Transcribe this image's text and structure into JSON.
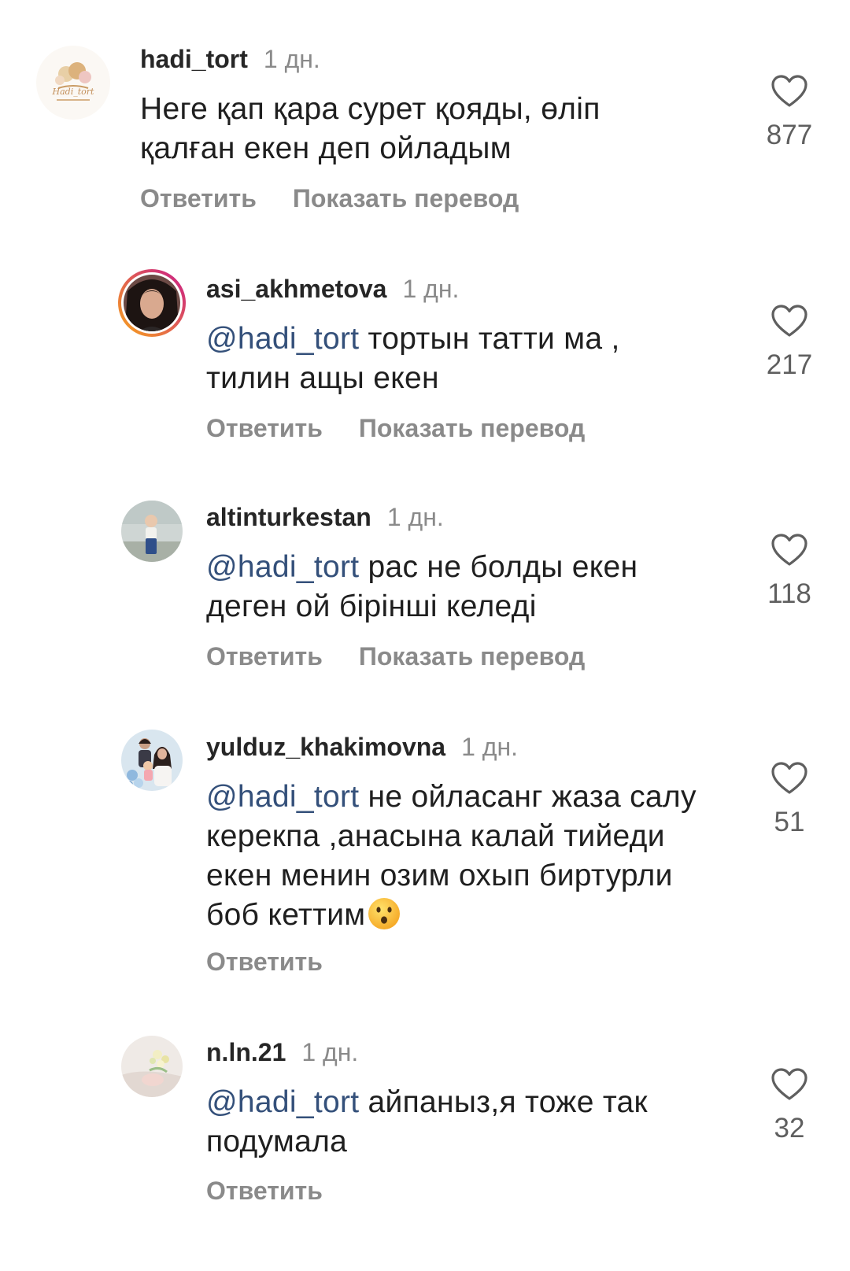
{
  "labels": {
    "reply": "Ответить",
    "translate": "Показать перевод"
  },
  "colors": {
    "mention": "#34507a",
    "muted": "#8a8a8a",
    "story_ring_start": "#f9a61a",
    "story_ring_end": "#c8198a"
  },
  "comments": [
    {
      "username": "hadi_tort",
      "time": "1 дн.",
      "text": "Неге қап қара сурет қояды, өліп қалған екен деп ойладым",
      "likes": "877",
      "avatar_icon": "hadi-tort-logo-avatar"
    },
    {
      "username": "asi_akhmetova",
      "time": "1 дн.",
      "mention": "@hadi_tort",
      "text": " тортын татти ма , тилин ащы екен",
      "likes": "217",
      "avatar_icon": "user-photo-avatar-with-story-ring"
    },
    {
      "username": "altinturkestan",
      "time": "1 дн.",
      "mention": "@hadi_tort",
      "text": " рас не болды екен деген ой бірінші келеді",
      "likes": "118",
      "avatar_icon": "child-photo-avatar"
    },
    {
      "username": "yulduz_khakimovna",
      "time": "1 дн.",
      "mention": "@hadi_tort",
      "text": " не ойласанг жаза салу керекпа ,анасына калай тийеди екен  менин озим охып биртурли боб кеттим",
      "likes": "51",
      "avatar_icon": "family-photo-avatar",
      "emoji": "hushed-face-emoji"
    },
    {
      "username": "n.ln.21",
      "time": "1 дн.",
      "mention": "@hadi_tort",
      "text": " айпаныз,я тоже так подумала",
      "likes": "32",
      "avatar_icon": "flowers-photo-avatar"
    }
  ]
}
